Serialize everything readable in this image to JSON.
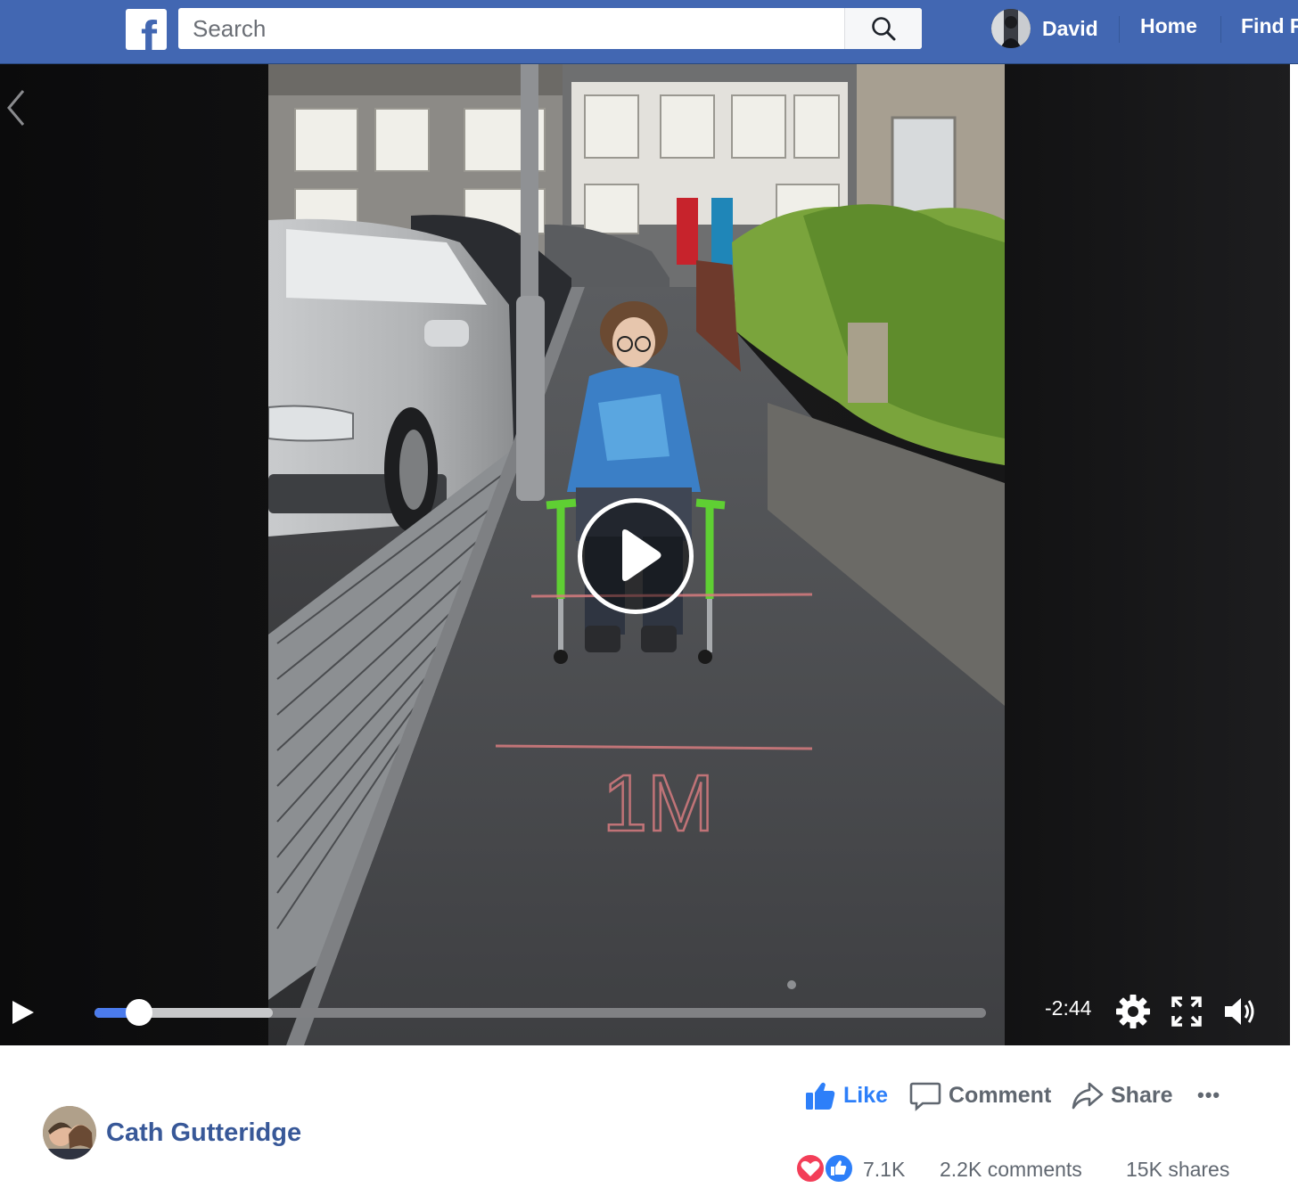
{
  "header": {
    "logo_letter": "f",
    "search": {
      "placeholder": "Search",
      "value": ""
    },
    "user_name": "David",
    "nav": [
      "Home",
      "Find F"
    ]
  },
  "video": {
    "time_remaining": "-2:44",
    "played_fraction": 0.05,
    "buffered_fraction": 0.2,
    "chalk_text": "1M"
  },
  "post": {
    "poster_name": "Cath Gutteridge",
    "actions": {
      "like": "Like",
      "comment": "Comment",
      "share": "Share",
      "more": "•••"
    },
    "stats": {
      "reactions": "7.1K",
      "comments": "2.2K comments",
      "shares": "15K shares"
    }
  },
  "colors": {
    "brand": "#4267b2",
    "like_blue": "#2d7ff9",
    "name_blue": "#385898",
    "love_red": "#f33e58"
  },
  "icons": [
    "facebook-logo-icon",
    "search-icon",
    "chevron-left-icon",
    "play-icon",
    "settings-gear-icon",
    "fullscreen-icon",
    "volume-icon",
    "like-thumb-icon",
    "comment-bubble-icon",
    "share-arrow-icon",
    "more-dots-icon",
    "love-heart-icon"
  ]
}
